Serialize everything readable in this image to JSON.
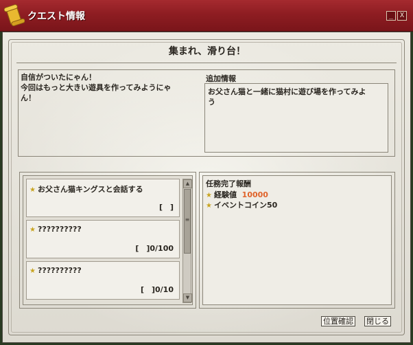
{
  "window": {
    "title": "クエスト情報",
    "minimize_glyph": "_",
    "close_glyph": "X",
    "icon": "scroll-icon",
    "colors": {
      "titlebar": "#8e1d22",
      "accent": "#e0632a",
      "star": "#c8a420"
    }
  },
  "quest": {
    "title": "集まれ、滑り台！",
    "dialogue_line1": "自信がついたにゃん！",
    "dialogue_line2": "今回はもっと大きい遊具を作ってみようにゃ",
    "dialogue_line3": "ん！",
    "additional_label": "追加情報",
    "additional_line1": "お父さん猫と一緒に猫村に遊び場を作ってみよ",
    "additional_line2": "う"
  },
  "objectives": [
    {
      "name": "お父さん猫キングスと会話する",
      "progress": "[　]"
    },
    {
      "name": "??????????",
      "progress": "[　]0/100"
    },
    {
      "name": "??????????",
      "progress": "[　]0/10"
    }
  ],
  "rewards": {
    "label": "任務完了報酬",
    "items": [
      {
        "name": "経験値",
        "value": "10000"
      },
      {
        "name": "イベントコイン50",
        "value": ""
      }
    ]
  },
  "scrollbar": {
    "up": "▲",
    "down": "▼",
    "grip": "≡"
  },
  "buttons": {
    "locate": "位置確認",
    "close": "閉じる"
  }
}
